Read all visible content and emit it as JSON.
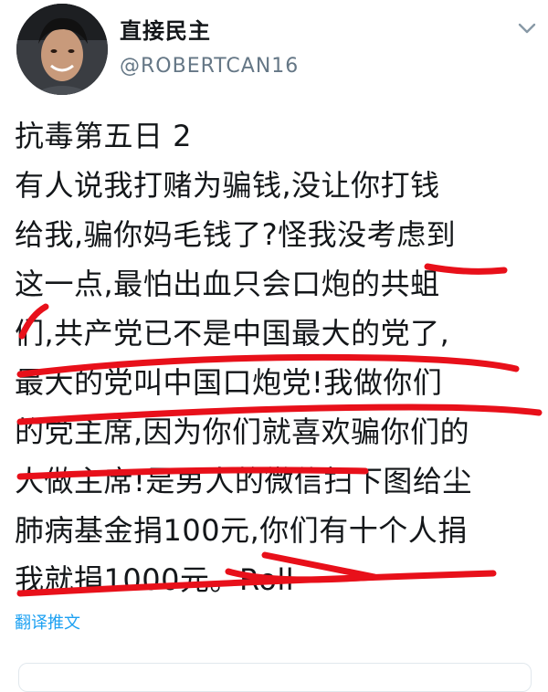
{
  "user": {
    "display_name": "直接民主",
    "handle": "@ROBERTCAN16"
  },
  "icons": {
    "menu": "chevron-down-icon"
  },
  "tweet": {
    "lines": [
      "抗毒第五日 2",
      "有人说我打赌为骗钱,没让你打钱",
      "给我,骗你妈毛钱了?怪我没考虑到",
      "这一点,最怕出血只会口炮的共蛆",
      "们,共产党已不是中国最大的党了,",
      "最大的党叫中国口炮党!我做你们",
      "的党主席,因为你们就喜欢骗你们的",
      "人做主席!是男人的微信扫下图给尘",
      "肺病基金捐100元,你们有十个人捐",
      "我就捐1000元。Roll"
    ]
  },
  "translate_label": "翻译推文",
  "colors": {
    "scribble": "#e8101a",
    "link": "#1da1f2",
    "handle": "#657786"
  }
}
